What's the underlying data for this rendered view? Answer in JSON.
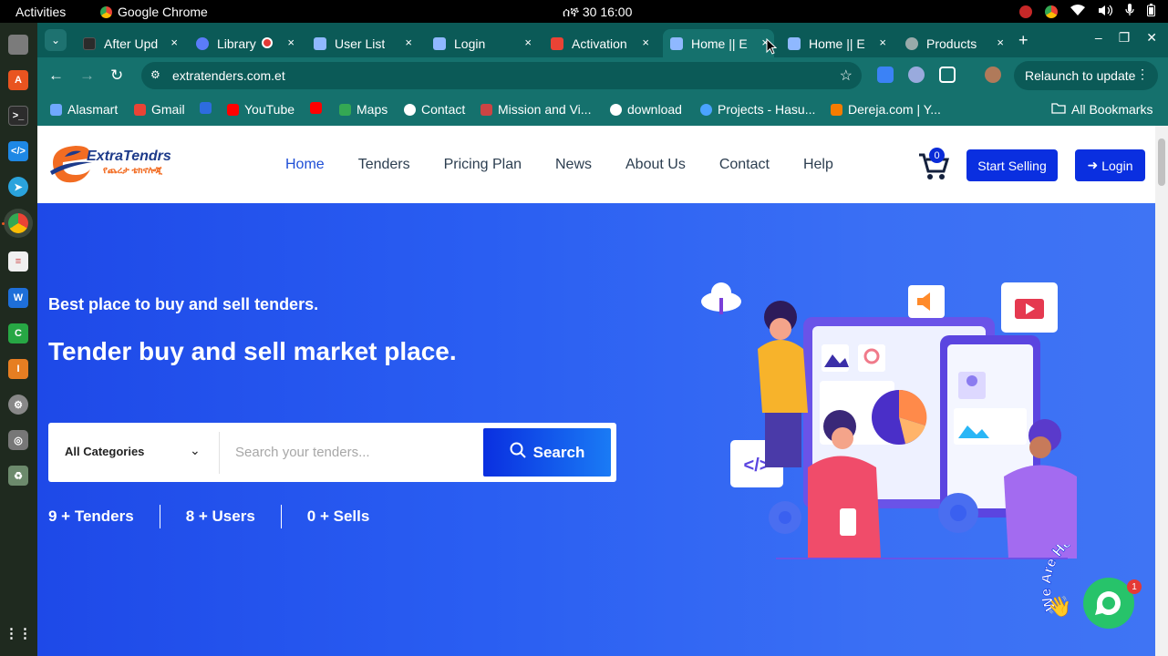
{
  "system": {
    "activities": "Activities",
    "app_name": "Google Chrome",
    "clock": "ሰኞ 30  16:00"
  },
  "browser": {
    "tabs": [
      {
        "title": "After Upd",
        "favicon": "globe",
        "color": "#2b2b2b"
      },
      {
        "title": "Library",
        "favicon": "star-burst",
        "color": "#5b7cfa"
      },
      {
        "title": "User List",
        "favicon": "site-logo",
        "color": "#8fb8ff"
      },
      {
        "title": "Login",
        "favicon": "site-logo",
        "color": "#8fb8ff"
      },
      {
        "title": "Activation",
        "favicon": "gmail",
        "color": "#ea4335"
      },
      {
        "title": "Home || E",
        "favicon": "site-logo",
        "color": "#8fb8ff",
        "active": true
      },
      {
        "title": "Home || E",
        "favicon": "site-logo",
        "color": "#8fb8ff"
      },
      {
        "title": "Products",
        "favicon": "globe",
        "color": "#9aa"
      }
    ],
    "close_glyph": "×",
    "url": "extratenders.com.et",
    "relaunch_label": "Relaunch to update",
    "bookmarks": [
      {
        "label": "Alasmart",
        "color": "#6fa8ff"
      },
      {
        "label": "Gmail",
        "color": "#ea4335"
      },
      {
        "label": "",
        "color": "#2d6cdf"
      },
      {
        "label": "YouTube",
        "color": "#ff0000"
      },
      {
        "label": "",
        "color": "#ff0000"
      },
      {
        "label": "Maps",
        "color": "#34a853"
      },
      {
        "label": "Contact",
        "color": "#ffffff"
      },
      {
        "label": "Mission and Vi...",
        "color": "#c44"
      },
      {
        "label": "download",
        "color": "#ffffff"
      },
      {
        "label": "Projects - Hasu...",
        "color": "#4aa3ff"
      },
      {
        "label": "Dereja.com | Y...",
        "color": "#f57c00"
      }
    ],
    "all_bookmarks": "All Bookmarks"
  },
  "site": {
    "logo_text": "ExtraTendrs",
    "logo_sub": "የጨረታ ቴክኖሎጂ",
    "nav": [
      "Home",
      "Tenders",
      "Pricing Plan",
      "News",
      "About Us",
      "Contact",
      "Help"
    ],
    "cart_count": "0",
    "start_selling": "Start Selling",
    "login": "Login",
    "hero_subtitle": "Best place to buy and sell tenders.",
    "hero_title": "Tender buy and sell market place.",
    "search": {
      "category": "All Categories",
      "placeholder": "Search your tenders...",
      "button": "Search"
    },
    "stats": [
      "9 + Tenders",
      "8 + Users",
      "0 + Sells"
    ],
    "chat": {
      "label": "We Are Here!",
      "badge": "1"
    }
  },
  "colors": {
    "brand_blue": "#0a2fe0",
    "hero_blue": "#2a5ef2",
    "chrome_teal": "#15716d"
  }
}
